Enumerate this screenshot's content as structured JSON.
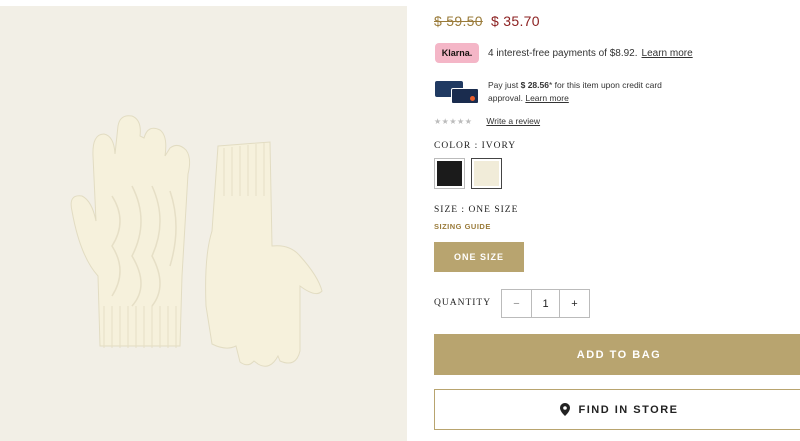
{
  "product_image": {
    "alt": ""
  },
  "price": {
    "original": "$ 59.50",
    "sale": "$ 35.70"
  },
  "klarna": {
    "badge": "Klarna.",
    "text": "4 interest-free payments of $8.92.",
    "link": "Learn more"
  },
  "card_promo": {
    "prefix": "Pay just ",
    "amount": "$ 28.56",
    "suffix": "* for this item upon credit card",
    "line2": "approval.",
    "link": "Learn more"
  },
  "reviews": {
    "stars": "★★★★★",
    "write_review": "Write a review"
  },
  "color": {
    "label": "COLOR :  IVORY",
    "swatches": [
      {
        "name": "black",
        "hex": "#1b1b1b"
      },
      {
        "name": "ivory",
        "hex": "#f1ecd9"
      }
    ]
  },
  "size": {
    "label": "SIZE : ONE SIZE",
    "guide": "SIZING GUIDE",
    "option": "ONE SIZE"
  },
  "quantity": {
    "label": "QUANTITY",
    "minus": "−",
    "value": "1",
    "plus": "+"
  },
  "actions": {
    "add_to_bag": "ADD TO BAG",
    "find_in_store": "FIND IN STORE"
  },
  "colors": {
    "accent": "#b8a46f",
    "sale": "#8b1f1f",
    "klarna": "#f4b6c7"
  }
}
